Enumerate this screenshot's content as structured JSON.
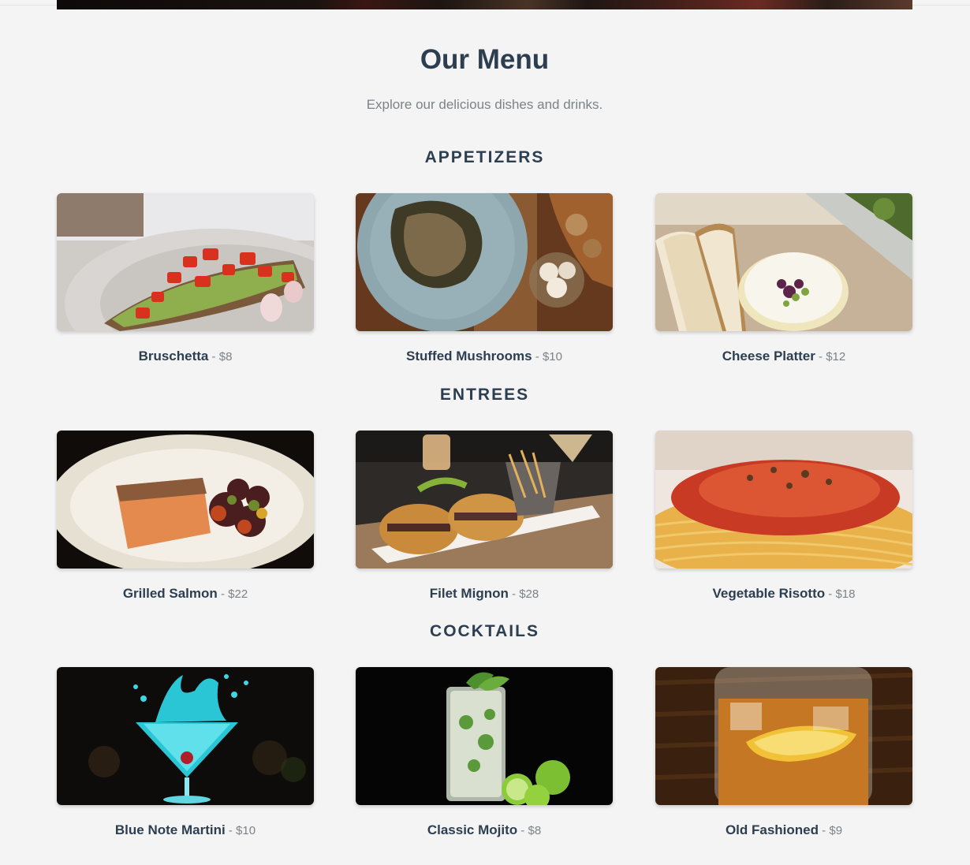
{
  "page": {
    "title": "Our Menu",
    "subtitle": "Explore our delicious dishes and drinks."
  },
  "price_separator": " - ",
  "sections": [
    {
      "title": "APPETIZERS",
      "items": [
        {
          "name": "Bruschetta",
          "price": "$8",
          "photo": "bruschetta-photo"
        },
        {
          "name": "Stuffed Mushrooms",
          "price": "$10",
          "photo": "stuffed-mushrooms-photo"
        },
        {
          "name": "Cheese Platter",
          "price": "$12",
          "photo": "cheese-platter-photo"
        }
      ]
    },
    {
      "title": "ENTREES",
      "items": [
        {
          "name": "Grilled Salmon",
          "price": "$22",
          "photo": "grilled-salmon-photo"
        },
        {
          "name": "Filet Mignon",
          "price": "$28",
          "photo": "filet-mignon-photo"
        },
        {
          "name": "Vegetable Risotto",
          "price": "$18",
          "photo": "vegetable-risotto-photo"
        }
      ]
    },
    {
      "title": "COCKTAILS",
      "items": [
        {
          "name": "Blue Note Martini",
          "price": "$10",
          "photo": "blue-note-martini-photo"
        },
        {
          "name": "Classic Mojito",
          "price": "$8",
          "photo": "classic-mojito-photo"
        },
        {
          "name": "Old Fashioned",
          "price": "$9",
          "photo": "old-fashioned-photo"
        }
      ]
    }
  ],
  "colors": {
    "background": "#f4f4f4",
    "heading": "#2c3e50",
    "muted": "#7b8388"
  }
}
